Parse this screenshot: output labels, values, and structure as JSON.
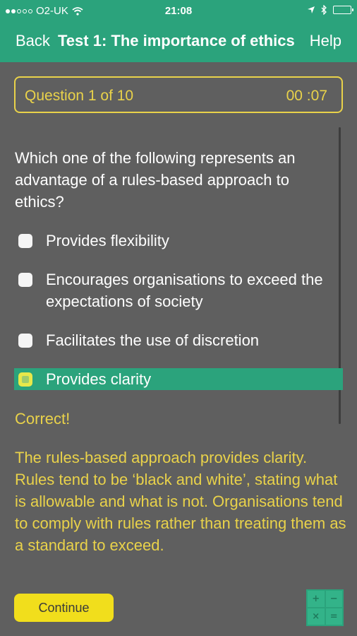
{
  "status_bar": {
    "carrier": "O2-UK",
    "time": "21:08"
  },
  "nav": {
    "back_label": "Back",
    "title": "Test 1: The importance of ethics",
    "help_label": "Help"
  },
  "quiz": {
    "question_counter": "Question 1 of 10",
    "timer": "00 :07",
    "question": "Which one of the following represents an advantage of a rules-based approach to ethics?",
    "options": [
      {
        "label": "Provides flexibility",
        "selected": false
      },
      {
        "label": "Encourages organisations to exceed the expectations of society",
        "selected": false
      },
      {
        "label": "Facilitates the use of discretion",
        "selected": false
      },
      {
        "label": "Provides clarity",
        "selected": true
      }
    ],
    "result": "Correct!",
    "explanation": "The rules-based approach provides clarity. Rules tend to be ‘black and white’, stating what is allowable and what is not. Organisations tend to comply with rules rather than treating them as a standard to exceed.",
    "continue_label": "Continue"
  },
  "calculator_icon": {
    "symbols": [
      "+",
      "−",
      "×",
      "="
    ]
  },
  "colors": {
    "header": "#2ba37c",
    "background": "#5f5f5f",
    "accent_yellow": "#e9d24a",
    "button_yellow": "#f1de1c"
  }
}
